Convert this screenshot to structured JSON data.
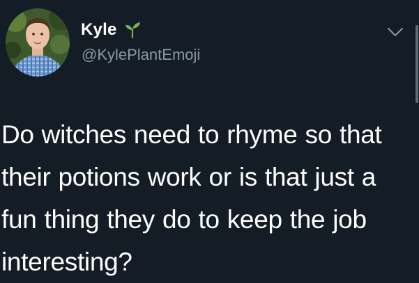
{
  "user": {
    "display_name": "Kyle",
    "handle": "@KylePlantEmoji",
    "name_emoji": "seedling-icon"
  },
  "tweet": {
    "text": "Do witches need to rhyme so that their potions work or is that just a fun thing they do to keep the job interesting?"
  },
  "controls": {
    "menu_icon": "chevron-down-icon"
  },
  "colors": {
    "background": "#141d26",
    "primary_text": "#ffffff",
    "secondary_text": "#8899a6",
    "sprout_green": "#77b255"
  }
}
